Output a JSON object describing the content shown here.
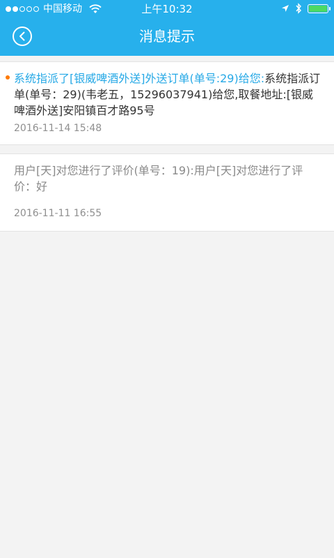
{
  "status_bar": {
    "carrier": "中国移动",
    "time": "上午10:32",
    "battery_color": "#4cd964"
  },
  "nav": {
    "title": "消息提示",
    "back_icon": "chevron-left-circle-icon"
  },
  "colors": {
    "header": "#27b0ec",
    "highlight": "#27a9e6",
    "unread_dot": "#ff7a00"
  },
  "messages": [
    {
      "unread": true,
      "highlight": "系统指派了[银威啤酒外送]外送订单(单号:29)给您:",
      "text": "系统指派订单(单号：29)(韦老五，15296037941)给您,取餐地址:[银威啤酒外送]安阳镇百才路95号",
      "date": "2016-11-14 15:48"
    },
    {
      "unread": false,
      "text": "用户[天]对您进行了评价(单号：19):用户[天]对您进行了评价：好",
      "date": "2016-11-11 16:55"
    }
  ]
}
